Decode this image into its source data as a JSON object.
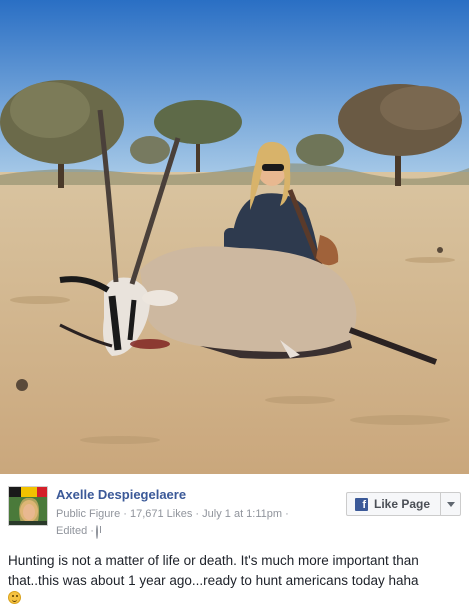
{
  "post": {
    "author_name": "Axelle Despiegelaere",
    "account_type": "Public Figure",
    "likes": "17,671 Likes",
    "separator": " · ",
    "date": "July 1 at 1:11pm",
    "edited": "Edited",
    "like_page_label": "Like Page",
    "body_text": "Hunting is not a matter of life or death. It's much more important than that..this was about 1 year ago...ready to hunt americans today haha"
  },
  "icons": {
    "brand": "facebook-f-icon",
    "privacy": "globe-icon",
    "dropdown": "chevron-down-icon",
    "emoji": "grin-emoji-icon"
  },
  "colors": {
    "name_link": "#3b5998",
    "meta_text": "#90949c",
    "body_text": "#1d2129",
    "button_bg": "#f6f7f9"
  }
}
